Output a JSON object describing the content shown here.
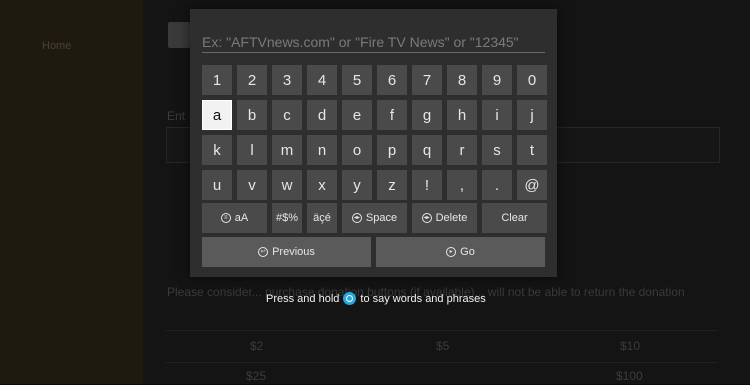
{
  "search": {
    "value": "",
    "placeholder": "Ex: \"AFTVnews.com\" or \"Fire TV News\" or \"12345\""
  },
  "keyboard": {
    "row1": [
      "1",
      "2",
      "3",
      "4",
      "5",
      "6",
      "7",
      "8",
      "9",
      "0"
    ],
    "row2": [
      "a",
      "b",
      "c",
      "d",
      "e",
      "f",
      "g",
      "h",
      "i",
      "j"
    ],
    "row3": [
      "k",
      "l",
      "m",
      "n",
      "o",
      "p",
      "q",
      "r",
      "s",
      "t"
    ],
    "row4": [
      "u",
      "v",
      "w",
      "x",
      "y",
      "z",
      "!",
      ",",
      ".",
      "@"
    ],
    "selected_key": "a",
    "case_label": "aA",
    "symbols_label": "#$%",
    "accents_label": "äçé",
    "space_label": "Space",
    "delete_label": "Delete",
    "clear_label": "Clear",
    "previous_label": "Previous",
    "go_label": "Go"
  },
  "hint": {
    "before": "Press and hold",
    "after": "to say words and phrases"
  },
  "background": {
    "nav_items": [
      "Home",
      "",
      "",
      "",
      "",
      ""
    ],
    "field_label": "Ent",
    "field_text": "",
    "paragraph": "Please consider... purchase donation buttons (if available)... will not be able to return the donation",
    "amounts_row1": [
      "$2",
      "$5",
      "$10"
    ],
    "amounts_row2": [
      "$25",
      "",
      "$100"
    ]
  },
  "colors": {
    "panel": "#2e2e2e",
    "key": "#4a4a4a",
    "key_selected": "#f2f2f2",
    "mic_accent": "#23a8e0"
  }
}
